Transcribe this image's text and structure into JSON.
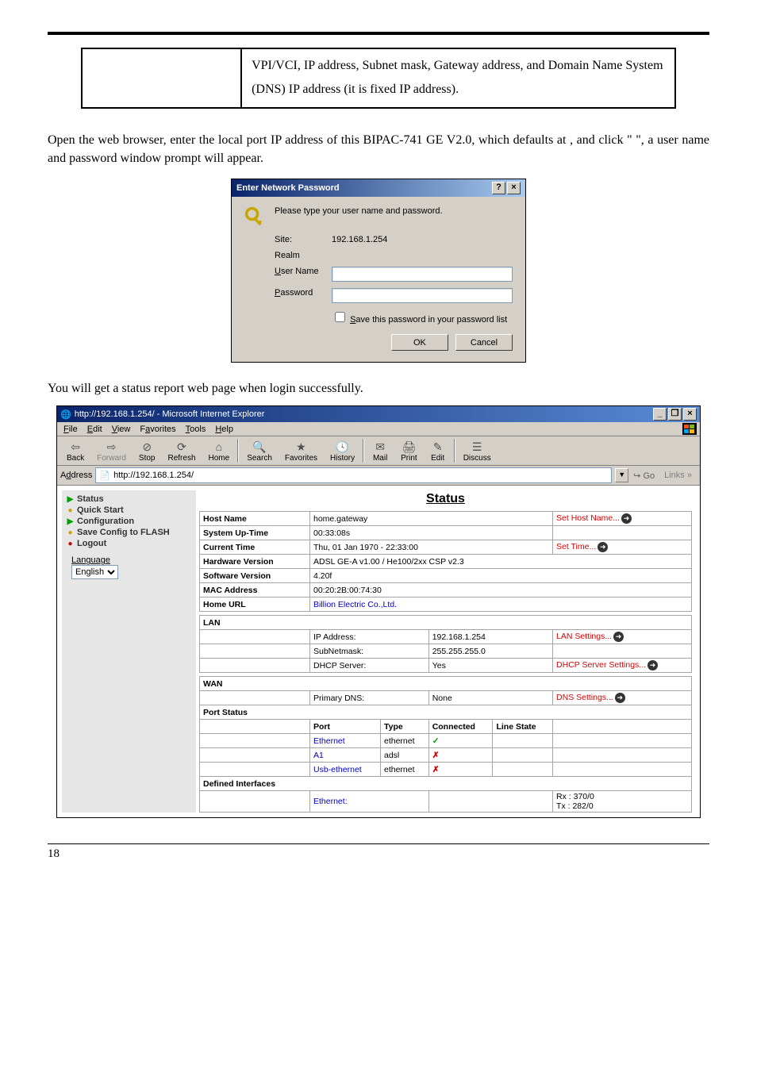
{
  "top_cell": "VPI/VCI, IP address, Subnet mask, Gateway address, and Domain Name System (DNS) IP address (it is fixed IP address).",
  "para1_a": "Open the web browser, enter the local port IP address of this BIPAC-741 GE V2.0, which defaults at ",
  "para1_b": ", and click \"   \", a user name and password window prompt will appear.",
  "dialog": {
    "title": "Enter Network Password",
    "prompt": "Please type your user name and password.",
    "site_label": "Site:",
    "site_value": "192.168.1.254",
    "realm_label": "Realm",
    "user_label_pre": "U",
    "user_label_post": "ser Name",
    "pass_label_pre": "P",
    "pass_label_post": "assword",
    "save_pre": "S",
    "save_post": "ave this password in your password list",
    "ok": "OK",
    "cancel": "Cancel"
  },
  "para2": "You will get a status report web page when login successfully.",
  "browser": {
    "title": "http://192.168.1.254/ - Microsoft Internet Explorer",
    "menus": {
      "file": "File",
      "edit": "Edit",
      "view": "View",
      "favorites": "Favorites",
      "tools": "Tools",
      "help": "Help"
    },
    "tb": {
      "back": "Back",
      "forward": "Forward",
      "stop": "Stop",
      "refresh": "Refresh",
      "home": "Home",
      "search": "Search",
      "favorites": "Favorites",
      "history": "History",
      "mail": "Mail",
      "print": "Print",
      "edit": "Edit",
      "discuss": "Discuss"
    },
    "addr_label": "Address",
    "addr_value": "http://192.168.1.254/",
    "go": "Go",
    "links": "Links"
  },
  "sidebar": {
    "status": "Status",
    "quick": "Quick Start",
    "config": "Configuration",
    "save": "Save Config to FLASH",
    "logout": "Logout",
    "lang_label": "Language",
    "lang_value": "English"
  },
  "status": {
    "heading": "Status",
    "rows": {
      "host_name_l": "Host Name",
      "host_name_v": "home.gateway",
      "host_name_a": "Set Host Name...",
      "uptime_l": "System Up-Time",
      "uptime_v": "00:33:08s",
      "curtime_l": "Current Time",
      "curtime_v": "Thu, 01 Jan 1970 - 22:33:00",
      "curtime_a": "Set Time...",
      "hwver_l": "Hardware Version",
      "hwver_v": "ADSL GE-A v1.00 / He100/2xx CSP v2.3",
      "swver_l": "Software Version",
      "swver_v": "4.20f",
      "mac_l": "MAC Address",
      "mac_v": "00:20:2B:00:74:30",
      "homeurl_l": "Home URL",
      "homeurl_v": "Billion Electric Co.,Ltd.",
      "lan_head": "LAN",
      "ip_l": "IP Address:",
      "ip_v": "192.168.1.254",
      "ip_a": "LAN Settings...",
      "subnet_l": "SubNetmask:",
      "subnet_v": "255.255.255.0",
      "dhcp_l": "DHCP Server:",
      "dhcp_v": "Yes",
      "dhcp_a": "DHCP Server Settings...",
      "wan_head": "WAN",
      "pdns_l": "Primary DNS:",
      "pdns_v": "None",
      "pdns_a": "DNS Settings...",
      "pstat_head": "Port Status",
      "port_h": "Port",
      "type_h": "Type",
      "conn_h": "Connected",
      "line_h": "Line State",
      "p1_port": "Ethernet",
      "p1_type": "ethernet",
      "p2_port": "A1",
      "p2_type": "adsl",
      "p3_port": "Usb-ethernet",
      "p3_type": "ethernet",
      "defif_head": "Defined Interfaces",
      "defif_port": "Ethernet:",
      "defif_stats": "Rx : 370/0\nTx : 282/0"
    }
  },
  "page_number": "18"
}
